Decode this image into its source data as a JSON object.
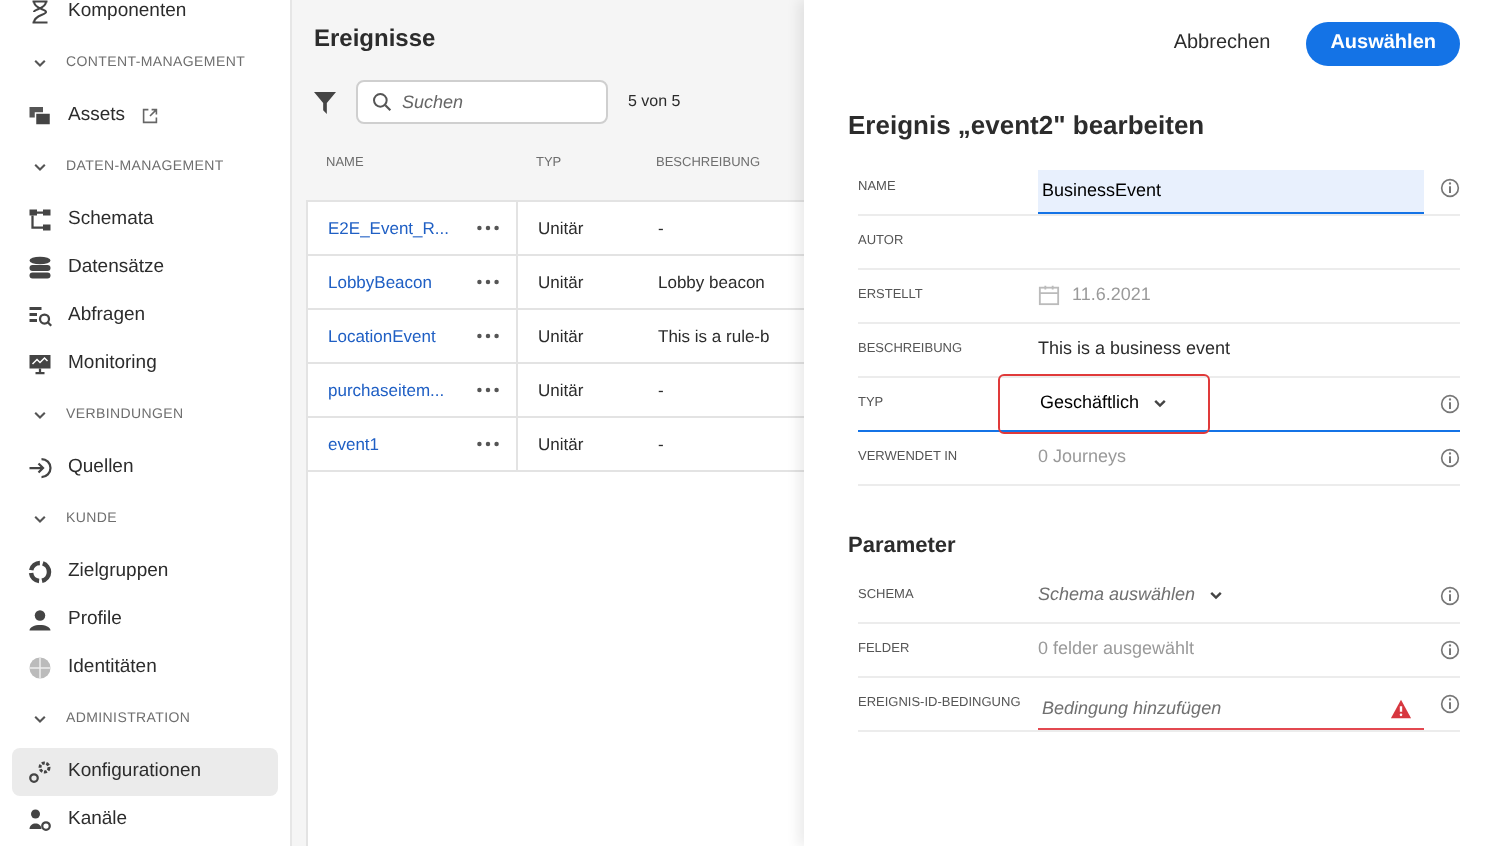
{
  "sidebar": {
    "items": [
      {
        "kind": "item",
        "label": "Komponenten",
        "selected": false
      },
      {
        "kind": "section",
        "label": "CONTENT-MANAGEMENT",
        "expanded": true
      },
      {
        "kind": "item",
        "label": "Assets",
        "selected": false,
        "external": true
      },
      {
        "kind": "section",
        "label": "DATEN-MANAGEMENT",
        "expanded": true
      },
      {
        "kind": "item",
        "label": "Schemata",
        "selected": false
      },
      {
        "kind": "item",
        "label": "Datensätze",
        "selected": false
      },
      {
        "kind": "item",
        "label": "Abfragen",
        "selected": false
      },
      {
        "kind": "item",
        "label": "Monitoring",
        "selected": false
      },
      {
        "kind": "section",
        "label": "VERBINDUNGEN",
        "expanded": true
      },
      {
        "kind": "item",
        "label": "Quellen",
        "selected": false
      },
      {
        "kind": "section",
        "label": "KUNDE",
        "expanded": true
      },
      {
        "kind": "item",
        "label": "Zielgruppen",
        "selected": false
      },
      {
        "kind": "item",
        "label": "Profile",
        "selected": false
      },
      {
        "kind": "item",
        "label": "Identitäten",
        "selected": false
      },
      {
        "kind": "section",
        "label": "ADMINISTRATION",
        "expanded": true
      },
      {
        "kind": "item",
        "label": "Konfigurationen",
        "selected": true
      },
      {
        "kind": "item",
        "label": "Kanäle",
        "selected": false
      }
    ]
  },
  "events": {
    "title": "Ereignisse",
    "search": {
      "placeholder": "Suchen"
    },
    "count": "5 von 5",
    "table": {
      "columns": [
        "NAME",
        "TYP",
        "BESCHREIBUNG"
      ],
      "rows": [
        {
          "name": "E2E_Event_R...",
          "type": "Unitär",
          "description": "-"
        },
        {
          "name": "LobbyBeacon",
          "type": "Unitär",
          "description": "Lobby beacon"
        },
        {
          "name": "LocationEvent",
          "type": "Unitär",
          "description": "This is a rule-b"
        },
        {
          "name": "purchaseitem...",
          "type": "Unitär",
          "description": "-"
        },
        {
          "name": "event1",
          "type": "Unitär",
          "description": "-"
        }
      ]
    }
  },
  "editor": {
    "buttons": [
      {
        "label": "Abbrechen",
        "kind": "quiet"
      },
      {
        "label": "Auswählen",
        "kind": "primary"
      }
    ],
    "title": "Ereignis „event2\" bearbeiten",
    "fields": [
      {
        "label": "NAME",
        "kind": "input",
        "value": "BusinessEvent",
        "focused": true,
        "info": true
      },
      {
        "label": "AUTOR",
        "kind": "text",
        "info": false
      },
      {
        "label": "ERSTELLT",
        "kind": "date",
        "value": "11.6.2021",
        "info": false
      },
      {
        "label": "BESCHREIBUNG",
        "kind": "text",
        "value": "This is a business event",
        "info": false
      },
      {
        "label": "TYP",
        "kind": "select",
        "value": "Geschäftlich",
        "highlighted": true,
        "info": true
      },
      {
        "label": "VERWENDET IN",
        "kind": "muted",
        "value": "0 Journeys",
        "info": true
      }
    ],
    "parameters_title": "Parameter",
    "parameters": [
      {
        "label": "SCHEMA",
        "kind": "select",
        "placeholder": "Schema auswählen",
        "highlighted": false,
        "info": true
      },
      {
        "label": "FELDER",
        "kind": "muted",
        "value": "0 felder ausgewählt",
        "info": true
      },
      {
        "label": "EREIGNIS-ID-BEDINGUNG",
        "kind": "input",
        "placeholder": "Bedingung hinzufügen",
        "focused": false,
        "error": true,
        "info": true
      }
    ]
  }
}
